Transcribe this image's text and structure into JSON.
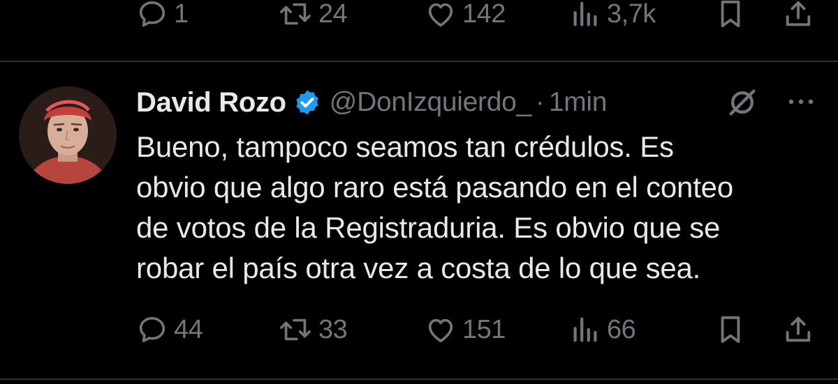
{
  "previous_tweet": {
    "actions": {
      "replies": "1",
      "retweets": "24",
      "likes": "142",
      "views": "3,7k"
    }
  },
  "tweet": {
    "author": {
      "display_name": "David Rozo",
      "handle": "@DonIzquierdo_",
      "verified": true
    },
    "separator": "·",
    "time": "1min",
    "text_lines": [
      "Bueno, tampoco seamos tan crédulos. Es",
      "obvio que algo raro está pasando en el conteo",
      "de votos de la Registraduria. Es obvio que se",
      "robar el país otra vez a costa de lo que sea."
    ],
    "actions": {
      "replies": "44",
      "retweets": "33",
      "likes": "151",
      "views": "66"
    }
  },
  "colors": {
    "background": "#000000",
    "text": "#e7e9ea",
    "muted": "#71767b",
    "divider": "#2f3336",
    "verified": "#1d9bf0"
  },
  "icons": {
    "reply": "speech-bubble-icon",
    "retweet": "retweet-arrows-icon",
    "like": "heart-icon",
    "views": "bar-chart-icon",
    "bookmark": "bookmark-icon",
    "share": "share-upload-icon",
    "grok": "grok-slash-circle-icon",
    "more": "ellipsis-icon",
    "verified": "verified-badge-icon"
  }
}
